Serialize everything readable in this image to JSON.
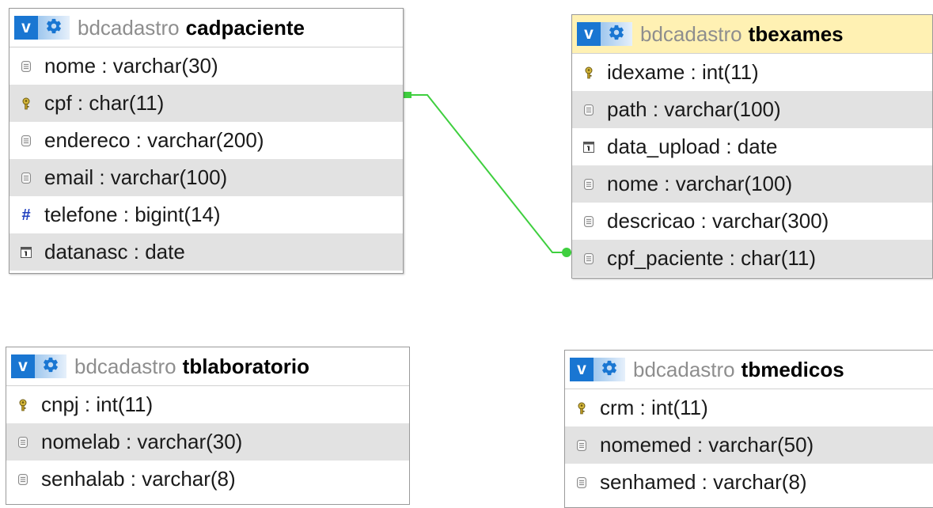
{
  "colors": {
    "header_button": "#1976d2",
    "row_alt": "#e2e2e2",
    "highlight_header": "#fff1b3",
    "relation_line": "#3fcf3f",
    "database_text": "#8e8e8e"
  },
  "tables": [
    {
      "database": "bdcadastro",
      "name": "cadpaciente",
      "highlighted": false,
      "collapse_label": "v",
      "columns": [
        {
          "text": "nome : varchar(30)",
          "icon": "column-icon"
        },
        {
          "text": "cpf : char(11)",
          "icon": "primary-key-icon"
        },
        {
          "text": "endereco : varchar(200)",
          "icon": "column-icon"
        },
        {
          "text": "email : varchar(100)",
          "icon": "column-icon"
        },
        {
          "text": "telefone : bigint(14)",
          "icon": "numeric-column-icon"
        },
        {
          "text": "datanasc : date",
          "icon": "date-column-icon"
        }
      ]
    },
    {
      "database": "bdcadastro",
      "name": "tbexames",
      "highlighted": true,
      "collapse_label": "v",
      "columns": [
        {
          "text": "idexame : int(11)",
          "icon": "primary-key-icon"
        },
        {
          "text": "path : varchar(100)",
          "icon": "column-icon"
        },
        {
          "text": "data_upload : date",
          "icon": "date-column-icon"
        },
        {
          "text": "nome : varchar(100)",
          "icon": "column-icon"
        },
        {
          "text": "descricao : varchar(300)",
          "icon": "column-icon"
        },
        {
          "text": "cpf_paciente : char(11)",
          "icon": "column-icon"
        }
      ]
    },
    {
      "database": "bdcadastro",
      "name": "tblaboratorio",
      "highlighted": false,
      "collapse_label": "v",
      "columns": [
        {
          "text": "cnpj : int(11)",
          "icon": "primary-key-icon"
        },
        {
          "text": "nomelab : varchar(30)",
          "icon": "column-icon"
        },
        {
          "text": "senhalab : varchar(8)",
          "icon": "column-icon"
        }
      ]
    },
    {
      "database": "bdcadastro",
      "name": "tbmedicos",
      "highlighted": false,
      "collapse_label": "v",
      "columns": [
        {
          "text": "crm : int(11)",
          "icon": "primary-key-icon"
        },
        {
          "text": "nomemed : varchar(50)",
          "icon": "column-icon"
        },
        {
          "text": "senhamed : varchar(8)",
          "icon": "column-icon"
        }
      ]
    }
  ],
  "relations": [
    {
      "from_table": "cadpaciente",
      "from_column": "cpf",
      "to_table": "tbexames",
      "to_column": "cpf_paciente"
    }
  ]
}
